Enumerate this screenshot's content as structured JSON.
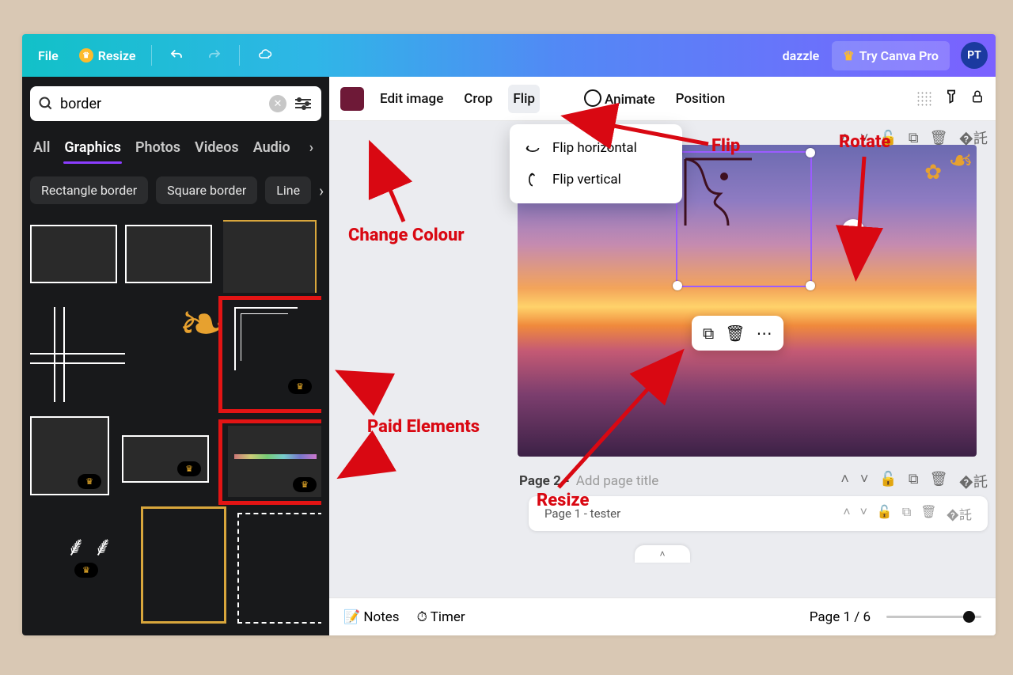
{
  "topbar": {
    "file": "File",
    "resize": "Resize",
    "docname": "dazzle",
    "try_pro": "Try Canva Pro",
    "avatar": "PT"
  },
  "search": {
    "value": "border"
  },
  "tabs": [
    "All",
    "Graphics",
    "Photos",
    "Videos",
    "Audio"
  ],
  "pills": [
    "Rectangle border",
    "Square border",
    "Line"
  ],
  "toolbar": {
    "edit_image": "Edit image",
    "crop": "Crop",
    "flip": "Flip",
    "animate": "Animate",
    "position": "Position"
  },
  "flip_menu": {
    "horizontal": "Flip horizontal",
    "vertical": "Flip vertical"
  },
  "page": {
    "label": "Page 2 -",
    "placeholder": "Add page title",
    "mini": "Page 1 - tester"
  },
  "footer": {
    "notes": "Notes",
    "timer": "Timer",
    "pagecount": "Page 1 / 6"
  },
  "annotations": {
    "change_colour": "Change Colour",
    "flip": "Flip",
    "rotate": "Rotate",
    "paid": "Paid Elements",
    "resize": "Resize"
  }
}
